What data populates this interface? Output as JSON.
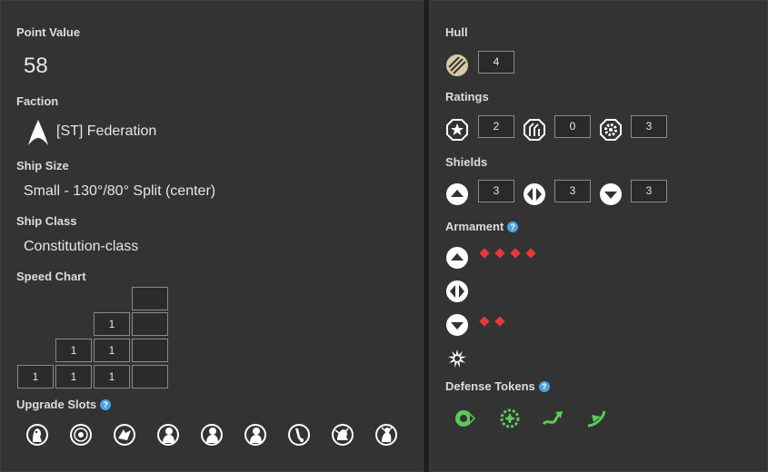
{
  "left": {
    "point_value_label": "Point Value",
    "point_value": "58",
    "faction_label": "Faction",
    "faction_value": "[ST] Federation",
    "faction_icon": "federation-delta-icon",
    "ship_size_label": "Ship Size",
    "ship_size_value": "Small - 130°/80° Split (center)",
    "ship_class_label": "Ship Class",
    "ship_class_value": "Constitution-class",
    "speed_chart_label": "Speed Chart",
    "speed_chart": [
      [
        "",
        "",
        "",
        ""
      ],
      [
        "",
        "",
        "1",
        ""
      ],
      [
        "",
        "1",
        "1",
        ""
      ],
      [
        "1",
        "1",
        "1",
        ""
      ]
    ],
    "upgrade_slots_label": "Upgrade Slots",
    "help_glyph": "?",
    "upgrade_slots": [
      "captain-upgrade-icon",
      "admiral-upgrade-icon",
      "squadron-upgrade-icon",
      "crew-upgrade-icon",
      "crew-upgrade-icon",
      "crew-upgrade-icon",
      "weapon-upgrade-icon",
      "tech-upgrade-icon",
      "elite-upgrade-icon"
    ]
  },
  "right": {
    "hull_label": "Hull",
    "hull_value": "4",
    "ratings_label": "Ratings",
    "ratings": [
      {
        "icon": "star-octagon-icon",
        "value": "2"
      },
      {
        "icon": "maneuver-arrows-icon",
        "value": "0"
      },
      {
        "icon": "gear-octagon-icon",
        "value": "3"
      }
    ],
    "shields_label": "Shields",
    "shields": [
      {
        "icon": "forward-arc-icon",
        "value": "3"
      },
      {
        "icon": "side-arcs-icon",
        "value": "3"
      },
      {
        "icon": "rear-arc-icon",
        "value": "3"
      }
    ],
    "armament_label": "Armament",
    "armament": [
      {
        "icon": "forward-arc-icon",
        "dice": 4
      },
      {
        "icon": "side-arcs-icon",
        "dice": 0
      },
      {
        "icon": "rear-arc-icon",
        "dice": 2
      },
      {
        "icon": "special-weapon-burst-icon",
        "dice": 0
      }
    ],
    "defense_tokens_label": "Defense Tokens",
    "defense_tokens": [
      "cloak-token-icon",
      "sensor-echo-token-icon",
      "evade-token-icon",
      "brace-token-icon"
    ],
    "colors": {
      "dice": "#e23b3b",
      "token": "#5ec95e",
      "help": "#4aa3df"
    }
  }
}
